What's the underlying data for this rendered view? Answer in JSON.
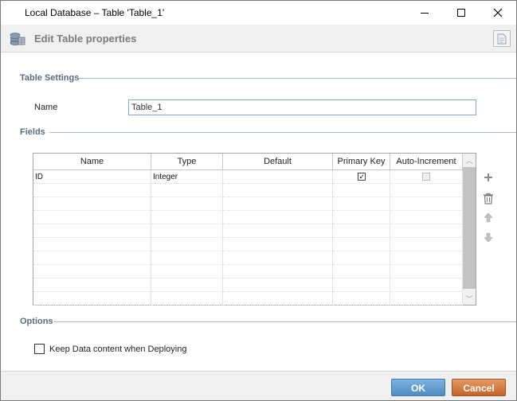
{
  "window": {
    "title": "Local Database – Table 'Table_1'"
  },
  "header": {
    "title": "Edit Table properties"
  },
  "sections": {
    "table_settings": "Table Settings",
    "fields": "Fields",
    "options": "Options"
  },
  "table_settings": {
    "name_label": "Name",
    "name_value": "Table_1"
  },
  "fields_grid": {
    "columns": [
      "Name",
      "Type",
      "Default",
      "Primary Key",
      "Auto-Increment"
    ],
    "rows": [
      {
        "name": "ID",
        "type": "Integer",
        "default": "",
        "primary_key": true,
        "auto_increment": false
      }
    ]
  },
  "options": {
    "keep_data_label": "Keep Data content when Deploying",
    "keep_data_checked": false
  },
  "footer": {
    "ok_label": "OK",
    "cancel_label": "Cancel"
  },
  "colors": {
    "ok_button": "#5b97cc",
    "cancel_button": "#d27339",
    "section_label": "#5a6d82"
  }
}
